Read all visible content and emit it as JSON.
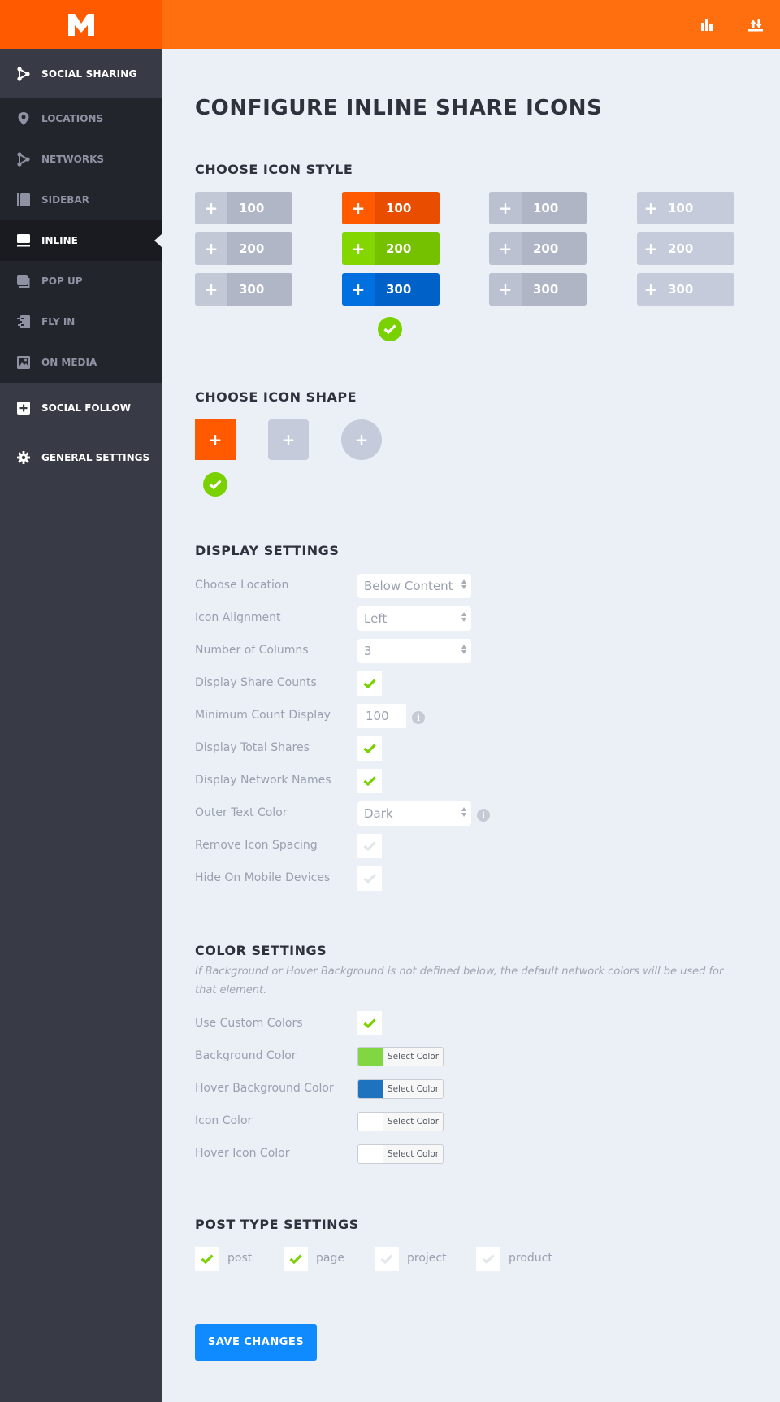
{
  "header": {
    "logo_letter": "M",
    "icons": [
      {
        "name": "stats-icon"
      },
      {
        "name": "import-export-icon"
      }
    ]
  },
  "sidebar": {
    "social_sharing": "SOCIAL SHARING",
    "sub_items": [
      {
        "label": "LOCATIONS",
        "icon": "location-pin-icon",
        "active": false
      },
      {
        "label": "NETWORKS",
        "icon": "share-network-icon",
        "active": false
      },
      {
        "label": "SIDEBAR",
        "icon": "sidebar-icon",
        "active": false
      },
      {
        "label": "INLINE",
        "icon": "inline-icon",
        "active": true
      },
      {
        "label": "POP UP",
        "icon": "popup-icon",
        "active": false
      },
      {
        "label": "FLY IN",
        "icon": "fly-in-icon",
        "active": false
      },
      {
        "label": "ON MEDIA",
        "icon": "image-icon",
        "active": false
      }
    ],
    "social_follow": "SOCIAL FOLLOW",
    "general_settings": "GENERAL SETTINGS"
  },
  "page": {
    "title": "CONFIGURE INLINE SHARE ICONS"
  },
  "icon_style": {
    "title": "CHOOSE ICON STYLE",
    "selected_index": 1,
    "columns": [
      {
        "buttons": [
          {
            "count": "100",
            "plus_color": "#c3c8d6",
            "count_color": "#b1b6c6"
          },
          {
            "count": "200",
            "plus_color": "#c3c8d6",
            "count_color": "#b1b6c6"
          },
          {
            "count": "300",
            "plus_color": "#c3c8d6",
            "count_color": "#b1b6c6"
          }
        ]
      },
      {
        "buttons": [
          {
            "count": "100",
            "plus_color": "#ff5a00",
            "count_color": "#e94e00"
          },
          {
            "count": "200",
            "plus_color": "#84d600",
            "count_color": "#75c100"
          },
          {
            "count": "300",
            "plus_color": "#0070e0",
            "count_color": "#0061c8"
          }
        ]
      },
      {
        "buttons": [
          {
            "count": "100",
            "plus_color": "#bcc1d1",
            "count_color": "#b0b5c6"
          },
          {
            "count": "200",
            "plus_color": "#bcc1d1",
            "count_color": "#b0b5c6"
          },
          {
            "count": "300",
            "plus_color": "#bcc1d1",
            "count_color": "#b0b5c6"
          }
        ]
      },
      {
        "buttons": [
          {
            "count": "100",
            "plus_color": "#c6cbdb",
            "count_color": "#c6cbdb"
          },
          {
            "count": "200",
            "plus_color": "#c6cbdb",
            "count_color": "#c6cbdb"
          },
          {
            "count": "300",
            "plus_color": "#c6cbdb",
            "count_color": "#c6cbdb"
          }
        ]
      }
    ]
  },
  "icon_shape": {
    "title": "CHOOSE ICON SHAPE",
    "selected_index": 0,
    "shapes": [
      {
        "name": "square",
        "color": "#ff5a00"
      },
      {
        "name": "rounded",
        "color": "#c6cbdb"
      },
      {
        "name": "circle",
        "color": "#c6cbdb"
      }
    ]
  },
  "display_settings": {
    "title": "DISPLAY SETTINGS",
    "choose_location": {
      "label": "Choose Location",
      "value": "Below Content"
    },
    "icon_alignment": {
      "label": "Icon Alignment",
      "value": "Left"
    },
    "number_of_columns": {
      "label": "Number of Columns",
      "value": "3"
    },
    "display_share_counts": {
      "label": "Display Share Counts",
      "checked": true
    },
    "minimum_count_display": {
      "label": "Minimum Count Display",
      "value": "100"
    },
    "display_total_shares": {
      "label": "Display Total Shares",
      "checked": true
    },
    "display_network_names": {
      "label": "Display Network Names",
      "checked": true
    },
    "outer_text_color": {
      "label": "Outer Text Color",
      "value": "Dark"
    },
    "remove_icon_spacing": {
      "label": "Remove Icon Spacing",
      "checked": false
    },
    "hide_on_mobile": {
      "label": "Hide On Mobile Devices",
      "checked": false
    }
  },
  "color_settings": {
    "title": "COLOR SETTINGS",
    "note": "If Background or Hover Background is not defined below, the default network colors will be used for that element.",
    "use_custom_colors": {
      "label": "Use Custom Colors",
      "checked": true
    },
    "select_label": "Select Color",
    "pickers": [
      {
        "label": "Background Color",
        "color": "#81d742"
      },
      {
        "label": "Hover Background Color",
        "color": "#1e73be"
      },
      {
        "label": "Icon Color",
        "color": "#ffffff"
      },
      {
        "label": "Hover Icon Color",
        "color": "#ffffff"
      }
    ]
  },
  "post_types": {
    "title": "POST TYPE SETTINGS",
    "items": [
      {
        "label": "post",
        "checked": true
      },
      {
        "label": "page",
        "checked": true
      },
      {
        "label": "project",
        "checked": false
      },
      {
        "label": "product",
        "checked": false
      }
    ]
  },
  "save_label": "SAVE CHANGES",
  "colors": {
    "accent_orange": "#ff6f0f",
    "check_green": "#7ad100",
    "save_blue": "#0f8bff"
  }
}
